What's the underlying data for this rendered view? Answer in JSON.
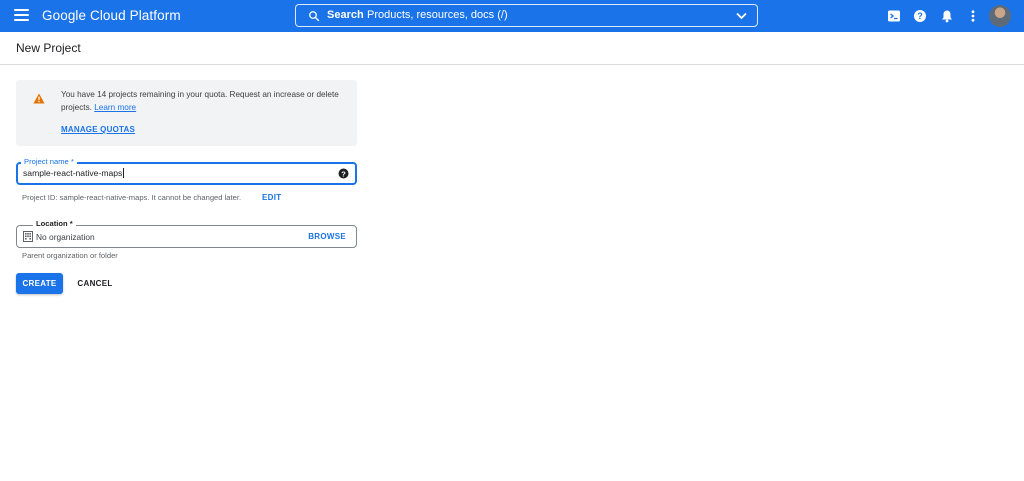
{
  "topbar": {
    "title": "Google Cloud Platform",
    "search_label": "Search",
    "search_placeholder": "Products, resources, docs (/)",
    "icons": [
      "menu-icon",
      "search-icon",
      "chevron-down-icon",
      "cloud-shell-icon",
      "help-icon",
      "notifications-icon",
      "more-vert-icon",
      "avatar"
    ],
    "color": "#1a73e8"
  },
  "page": {
    "title": "New Project"
  },
  "quota_notice": {
    "message": "You have 14 projects remaining in your quota. Request an increase or delete projects.",
    "learn_more": "Learn more",
    "manage_quotas": "MANAGE QUOTAS"
  },
  "project_name": {
    "label": "Project name *",
    "value": "sample-react-native-maps",
    "project_id_hint": "Project ID: sample-react-native-maps. It cannot be changed later.",
    "edit_label": "EDIT"
  },
  "location": {
    "label": "Location *",
    "value": "No organization",
    "browse_label": "BROWSE",
    "hint": "Parent organization or folder"
  },
  "actions": {
    "create": "CREATE",
    "cancel": "CANCEL"
  },
  "colors": {
    "accent": "#1a73e8",
    "warning": "#e37400",
    "notice_bg": "#f1f3f4"
  }
}
